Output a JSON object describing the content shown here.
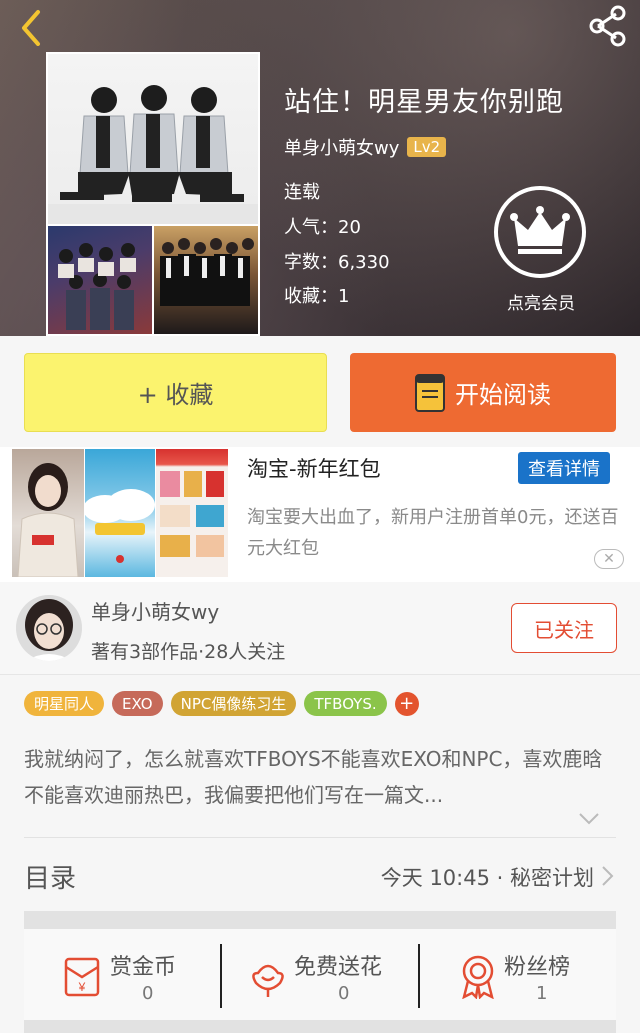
{
  "book": {
    "title": "站住！明星男友你别跑",
    "author": "单身小萌女wy",
    "level": "Lv2",
    "status": "连载",
    "popularity": "人气：20",
    "word_count": "字数：6,330",
    "favorites": "收藏：1",
    "vip_label": "点亮会员"
  },
  "buttons": {
    "collect": "+ 收藏",
    "read": "开始阅读"
  },
  "ad": {
    "title": "淘宝-新年红包",
    "detail_button": "查看详情",
    "description": "淘宝要大出血了，新用户注册首单0元，还送百元大红包",
    "close": "✕"
  },
  "author": {
    "name": "单身小萌女wy",
    "stats": "著有3部作品·28人关注",
    "follow_button": "已关注"
  },
  "tags": [
    {
      "label": "明星同人",
      "color": "#f0b43c"
    },
    {
      "label": "EXO",
      "color": "#c66a5a"
    },
    {
      "label": "NPC偶像练习生",
      "color": "#d1a434"
    },
    {
      "label": "TFBOYS.",
      "color": "#8bc44a"
    }
  ],
  "tag_add": "+",
  "description": "我就纳闷了，怎么就喜欢TFBOYS不能喜欢EXO和NPC，喜欢鹿晗不能喜欢迪丽热巴，我偏要把他们写在一篇文...",
  "toc": {
    "title": "目录",
    "latest": "今天 10:45 · 秘密计划"
  },
  "actions": [
    {
      "label": "赏金币",
      "count": "0",
      "icon": "coin-envelope-icon"
    },
    {
      "label": "免费送花",
      "count": "0",
      "icon": "flower-icon"
    },
    {
      "label": "粉丝榜",
      "count": "1",
      "icon": "medal-icon"
    }
  ],
  "colors": {
    "accent_orange": "#ee6a32",
    "collect_yellow": "#fbf36e",
    "follow_red": "#e34d33",
    "ad_blue": "#1a73c9"
  }
}
